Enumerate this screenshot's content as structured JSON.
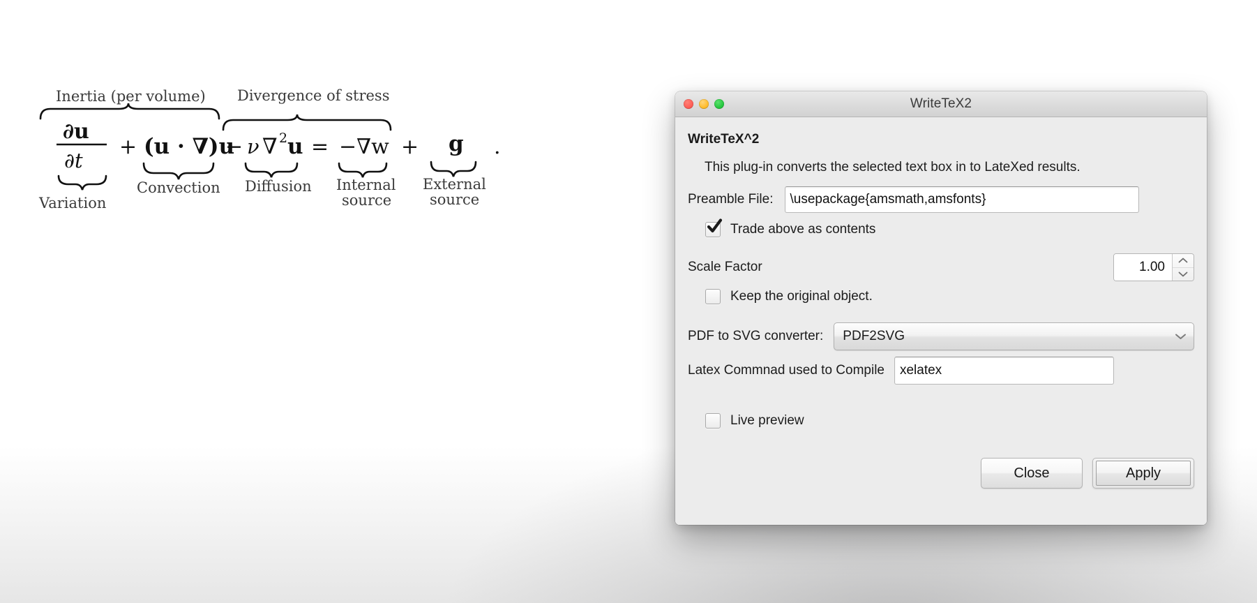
{
  "equation": {
    "name": "navier-stokes-momentum-equation",
    "description": "Navier-Stokes momentum equation with annotated braces",
    "top_labels": [
      "Inertia (per volume)",
      "Divergence of stress"
    ],
    "bottom_labels": [
      "Variation",
      "Convection",
      "Diffusion",
      "Internal source",
      "External source"
    ],
    "terms": {
      "partial_numerator": "∂u",
      "partial_denominator": "∂t",
      "plus_1": "+",
      "convection": "(u · ∇)u",
      "minus": "−",
      "diffusion_nu": "ν",
      "diffusion_lap": "∇",
      "diffusion_exp": "2",
      "diffusion_u": "u",
      "equals": "=",
      "internal_source": "−∇w",
      "plus_2": "+",
      "external_source": "g",
      "period": "."
    }
  },
  "window": {
    "title": "WriteTeX2",
    "traffic_lights": [
      {
        "name": "close",
        "color": "#ff5f57"
      },
      {
        "name": "minimize",
        "color": "#ffbd2e"
      },
      {
        "name": "zoom",
        "color": "#28c840"
      }
    ]
  },
  "dialog": {
    "heading": "WriteTeX^2",
    "description": "This plug-in converts the selected text box in to LateXed results.",
    "preamble": {
      "label": "Preamble File:",
      "value": "\\usepackage{amsmath,amsfonts}",
      "placeholder": ""
    },
    "trade_checkbox": {
      "label": "Trade above as contents",
      "checked": true
    },
    "scale_factor": {
      "label": "Scale Factor",
      "value": "1.00"
    },
    "keep_original_checkbox": {
      "label": "Keep the original object.",
      "checked": false
    },
    "converter": {
      "label": "PDF to SVG converter:",
      "value": "PDF2SVG",
      "options": [
        "PDF2SVG"
      ]
    },
    "latex_command": {
      "label": "Latex Commnad used to Compile",
      "value": "xelatex",
      "placeholder": ""
    },
    "live_preview_checkbox": {
      "label": "Live preview",
      "checked": false
    },
    "buttons": {
      "close": "Close",
      "apply": "Apply"
    }
  }
}
